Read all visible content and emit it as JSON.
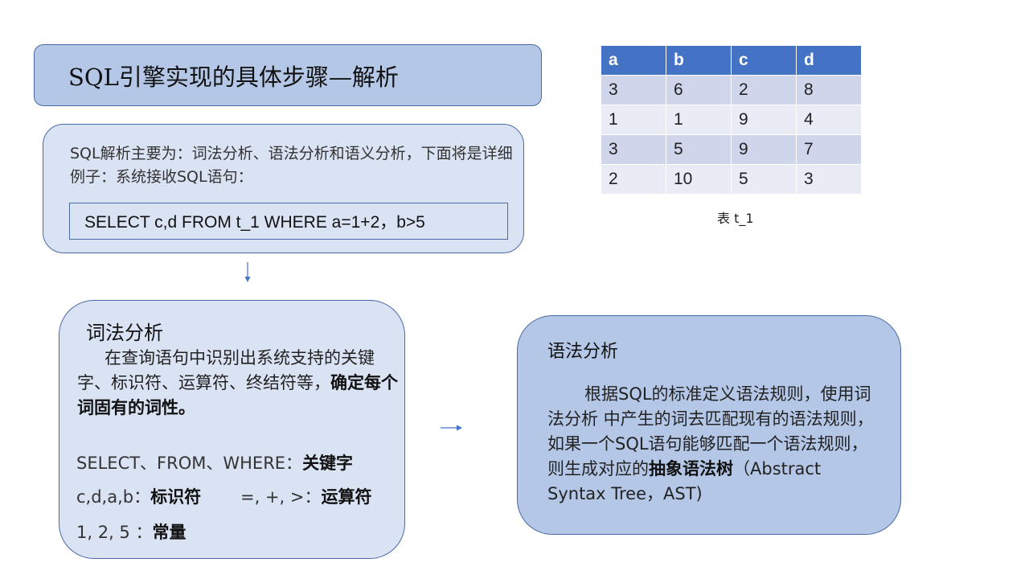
{
  "title": "SQL引擎实现的具体步骤—解析",
  "intro": {
    "text": "SQL解析主要为：词法分析、语法分析和语义分析，下面将是详细例子：系统接收SQL语句：",
    "sql": "SELECT c,d  FROM t_1 WHERE a=1+2，b>5"
  },
  "lexical": {
    "heading": "词法分析",
    "para_plain": "在查询语句中识别出系统支持的关键字、标识符、运算符、终结符等，",
    "para_bold": "确定每个词固有的词性。",
    "line1_plain": "SELECT、FROM、WHERE：",
    "line1_bold": "关键字",
    "line2_plain": "c,d,a,b：",
    "line2_bold": "标识符",
    "line2b_plain": "=, +, >：",
    "line2b_bold": "运算符",
    "line3_plain": "1, 2, 5 ：",
    "line3_bold": "常量"
  },
  "syntax": {
    "heading": "语法分析",
    "para_plain": "根据SQL的标准定义语法规则，使用词法分析 中产生的词去匹配现有的语法规则，如果一个SQL语句能够匹配一个语法规则，则生成对应的",
    "para_bold": "抽象语法树",
    "para_tail": "（Abstract Syntax Tree，AST)"
  },
  "table": {
    "headers": [
      "a",
      "b",
      "c",
      "d"
    ],
    "rows": [
      [
        "3",
        "6",
        "2",
        "8"
      ],
      [
        "1",
        "1",
        "9",
        "4"
      ],
      [
        "3",
        "5",
        "9",
        "7"
      ],
      [
        "2",
        "10",
        "5",
        "3"
      ]
    ],
    "caption": "表 t_1"
  },
  "colors": {
    "title_fill": "#b4c7e7",
    "light_fill": "#dae3f3",
    "border": "#4a6aa5",
    "table_header": "#4472c4",
    "table_row_odd": "#cfd5ea",
    "table_row_even": "#e9ebf5"
  },
  "icons": [
    "arrow-down-icon",
    "arrow-right-icon"
  ]
}
